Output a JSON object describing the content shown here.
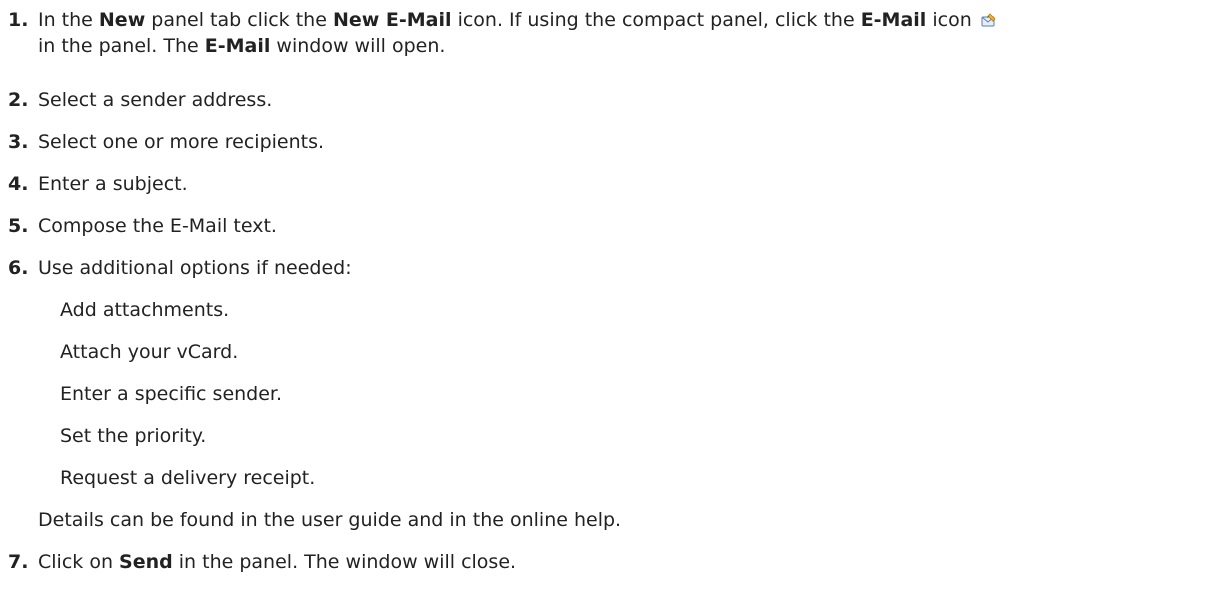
{
  "steps": [
    {
      "num": "1.",
      "t1": "In the ",
      "b1": "New",
      "t2": " panel tab click the ",
      "b2": "New E-Mail",
      "t3": " icon. If using the compact panel, click the ",
      "b3": "E-Mail",
      "t4": " icon",
      "line2_t1": "in the panel.  The ",
      "line2_b1": "E-Mail",
      "line2_t2": " window will open.",
      "icon": "email-compose-icon"
    },
    {
      "num": "2.",
      "text": "Select a sender address."
    },
    {
      "num": "3.",
      "text": "Select one or more recipients."
    },
    {
      "num": "4.",
      "text": "Enter a subject."
    },
    {
      "num": "5.",
      "text": "Compose the E-Mail text."
    },
    {
      "num": "6.",
      "text": "Use additional options if needed:"
    },
    {
      "num": "7.",
      "t1": "Click on ",
      "b1": "Send",
      "t2": " in the panel. The window will close."
    }
  ],
  "options": [
    "Add attachments.",
    "Attach your vCard.",
    "Enter a specific sender.",
    "Set the priority.",
    "Request a delivery receipt."
  ],
  "note": "Details can be found in the user guide and in the online help."
}
